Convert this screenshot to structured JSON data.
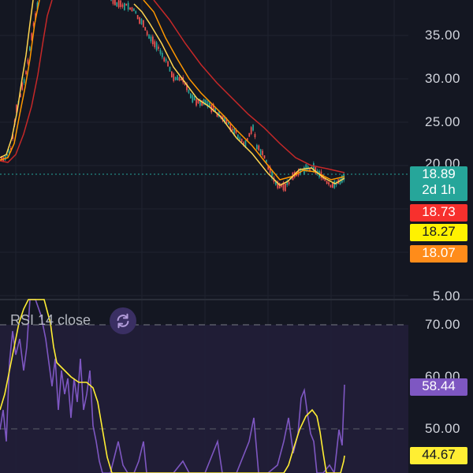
{
  "price_axis": {
    "ticks": [
      "35.00",
      "30.00",
      "25.00",
      "20.00",
      "5.00"
    ]
  },
  "price_tags": {
    "current_price": "18.89",
    "countdown": "2d 1h",
    "ma_red": "18.73",
    "ma_yellow": "18.27",
    "ma_orange": "18.07"
  },
  "rsi_pane": {
    "legend": "RSI 14 close",
    "axis_ticks": [
      "70.00",
      "60.00",
      "50.00"
    ],
    "rsi_value": "58.44",
    "rsi_ma_value": "44.67"
  },
  "colors": {
    "background": "#141722",
    "candle_up": "#26a69a",
    "candle_down": "#ef5350",
    "ma_red": "#c62828",
    "ma_yellow": "#ffd54f",
    "ma_orange": "#ff9800",
    "rsi_line": "#7e57c2",
    "rsi_ma_line": "#ffee33"
  },
  "icons": {
    "refresh": "refresh-icon"
  }
}
